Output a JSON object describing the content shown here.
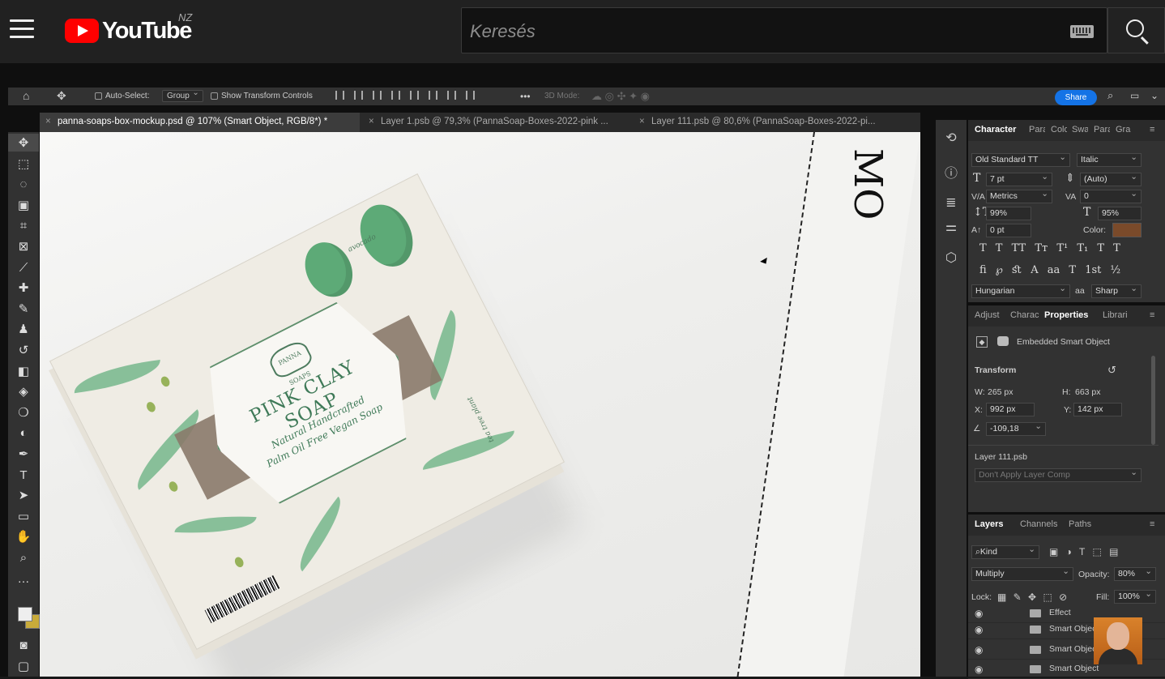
{
  "youtube": {
    "logo_text": "YouTube",
    "region": "NZ",
    "search_placeholder": "Keresés"
  },
  "photoshop": {
    "options_bar": {
      "auto_select_label": "Auto-Select:",
      "auto_select_value": "Group",
      "show_transform_label": "Show Transform Controls",
      "more": "•••",
      "mode_3d": "3D Mode:",
      "share_label": "Share"
    },
    "tabs": [
      {
        "label": "panna-soaps-box-mockup.psd @ 107% (Smart Object, RGB/8*) *",
        "active": true
      },
      {
        "label": "Layer 1.psb @ 79,3% (PannaSoap-Boxes-2022-pink ...",
        "active": false
      },
      {
        "label": "Layer 111.psb @ 80,6% (PannaSoap-Boxes-2022-pi...",
        "active": false
      }
    ],
    "canvas": {
      "soap_title": "PINK CLAY SOAP",
      "soap_sub1": "Natural Handcrafted",
      "soap_sub2": "Palm Oil Free Vegan Soap",
      "brand_logo_text": "PANNA SOAPS",
      "avocado_text": "avocado",
      "tea_tree_text": "tea tree plant",
      "right_text": "MO"
    },
    "character_panel": {
      "tabs": [
        "Character",
        "Para",
        "Colo",
        "Swa",
        "Para",
        "Gra"
      ],
      "font_family": "Old Standard TT",
      "font_style": "Italic",
      "font_size": "7 pt",
      "leading": "(Auto)",
      "kerning": "Metrics",
      "tracking": "0",
      "vertical_scale": "99%",
      "horizontal_scale": "95%",
      "baseline_shift": "0 pt",
      "color_label": "Color:",
      "color_swatch": "#7a4a2a",
      "language": "Hungarian",
      "antialias_icon": "aa",
      "antialias": "Sharp"
    },
    "properties_panel": {
      "tabs": [
        "Adjust",
        "Charac",
        "Properties",
        "Librari"
      ],
      "object_type": "Embedded Smart Object",
      "transform_title": "Transform",
      "w_label": "W:",
      "w": "265 px",
      "h_label": "H:",
      "h": "663 px",
      "x_label": "X:",
      "x": "992 px",
      "y_label": "Y:",
      "y": "142 px",
      "angle": "-109,18",
      "layer_name": "Layer 111.psb",
      "layer_comp": "Don't Apply Layer Comp"
    },
    "layers_panel": {
      "tabs": [
        "Layers",
        "Channels",
        "Paths"
      ],
      "filter_kind": "Kind",
      "blend_mode": "Multiply",
      "opacity_label": "Opacity:",
      "opacity": "80%",
      "lock_label": "Lock:",
      "fill_label": "Fill:",
      "fill": "100%",
      "rows": [
        {
          "name": "Effect"
        },
        {
          "name": "Smart Object"
        },
        {
          "name": "Smart Object"
        },
        {
          "name": "Smart Object"
        }
      ]
    }
  }
}
